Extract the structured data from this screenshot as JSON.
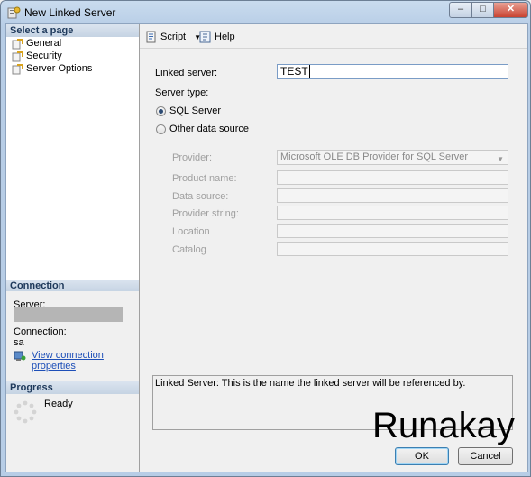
{
  "window": {
    "title": "New Linked Server"
  },
  "left": {
    "select_page_header": "Select a page",
    "pages": [
      "General",
      "Security",
      "Server Options"
    ],
    "connection_header": "Connection",
    "server_label": "Server:",
    "connection_label": "Connection:",
    "connection_value": "sa",
    "view_props_link": "View connection properties",
    "progress_header": "Progress",
    "progress_status": "Ready"
  },
  "toolbar": {
    "script_label": "Script",
    "help_label": "Help"
  },
  "form": {
    "linked_server_label": "Linked server:",
    "linked_server_value": "TEST",
    "server_type_label": "Server type:",
    "sql_server_option": "SQL Server",
    "other_source_option": "Other data source",
    "provider_label": "Provider:",
    "provider_value": "Microsoft OLE DB Provider for SQL Server",
    "product_name_label": "Product name:",
    "data_source_label": "Data source:",
    "provider_string_label": "Provider string:",
    "location_label": "Location",
    "catalog_label": "Catalog"
  },
  "description": "Linked Server: This is the name the linked server will be referenced by.",
  "watermark": "Runakay",
  "buttons": {
    "ok": "OK",
    "cancel": "Cancel"
  }
}
